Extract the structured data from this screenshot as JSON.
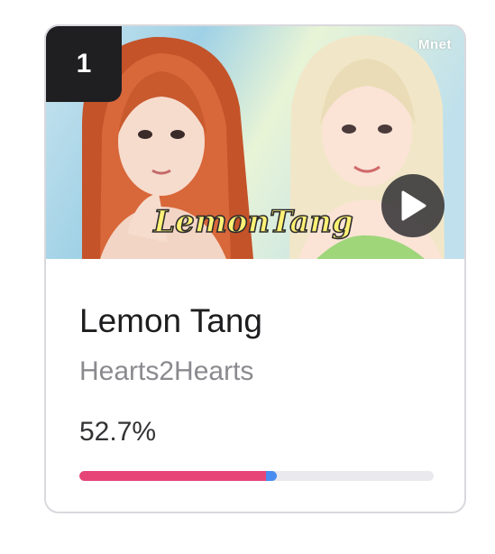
{
  "card": {
    "rank": "1",
    "title": "Lemon Tang",
    "artist": "Hearts2Hearts",
    "percent_label": "52.7%",
    "progress": 0.527,
    "colors": {
      "progress_fill": "#e64677",
      "progress_tip": "#4a8cf0",
      "progress_track": "#e9e9ee",
      "badge": "#1f1f22"
    }
  },
  "thumbnail": {
    "watermark": "Mnet",
    "logo_text": "LemonTang",
    "play_icon": "play-icon"
  }
}
